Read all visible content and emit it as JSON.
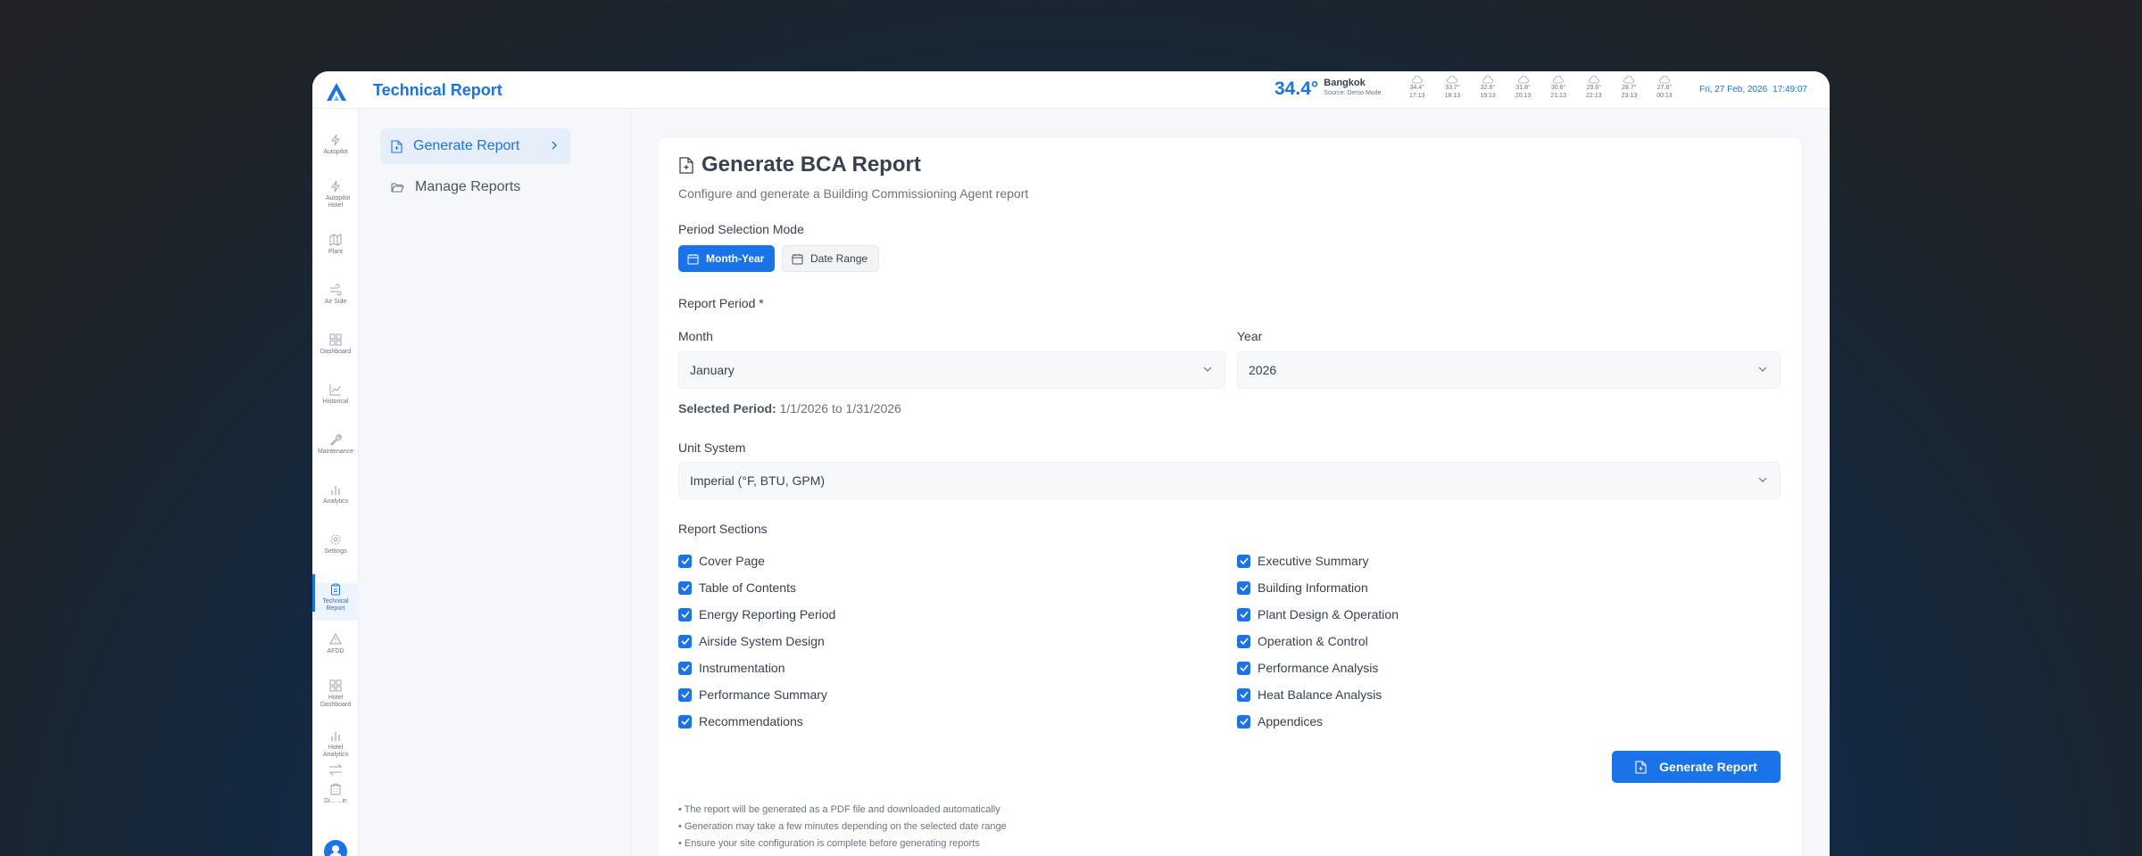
{
  "app": {
    "title": "Technical Report"
  },
  "weather": {
    "current_temp": "34.4°",
    "location": "Bangkok",
    "source": "Source: Demo Mode",
    "forecast": [
      {
        "temp": "34.4°",
        "time": "17:13"
      },
      {
        "temp": "33.7°",
        "time": "18:13"
      },
      {
        "temp": "32.6°",
        "time": "19:13"
      },
      {
        "temp": "31.8°",
        "time": "20:13"
      },
      {
        "temp": "30.6°",
        "time": "21:13"
      },
      {
        "temp": "29.6°",
        "time": "22:13"
      },
      {
        "temp": "28.7°",
        "time": "23:13"
      },
      {
        "temp": "27.6°",
        "time": "00:13"
      }
    ]
  },
  "datetime": {
    "date": "Fri, 27 Feb, 2026",
    "time": "17:49:07"
  },
  "sidebar": {
    "items": [
      {
        "label": "Autopilot",
        "icon": "bolt-icon"
      },
      {
        "label": "Autopilot Hotel",
        "icon": "bolt-icon"
      },
      {
        "label": "Plant",
        "icon": "map-icon"
      },
      {
        "label": "Air Side",
        "icon": "wind-icon"
      },
      {
        "label": "Dashboard",
        "icon": "grid-icon"
      },
      {
        "label": "Historical",
        "icon": "line-chart-icon"
      },
      {
        "label": "Maintenance",
        "icon": "wrench-icon"
      },
      {
        "label": "Analytics",
        "icon": "bar-chart-icon"
      },
      {
        "label": "Settings",
        "icon": "gear-icon"
      },
      {
        "label": "Technical Report",
        "icon": "clipboard-icon"
      },
      {
        "label": "AFDD",
        "icon": "warning-icon"
      },
      {
        "label": "Hotel Dashboard",
        "icon": "grid-icon"
      },
      {
        "label": "Hotel Analytics",
        "icon": "bar-chart-icon"
      },
      {
        "label": "Di... ...in",
        "icon": "building-icon"
      }
    ]
  },
  "subnav": {
    "generate": "Generate Report",
    "manage": "Manage Reports"
  },
  "main": {
    "title": "Generate BCA Report",
    "subtitle": "Configure and generate a Building Commissioning Agent report",
    "period_mode_label": "Period Selection Mode",
    "mode_month_year": "Month-Year",
    "mode_date_range": "Date Range",
    "report_period_label": "Report Period *",
    "month_label": "Month",
    "month_value": "January",
    "year_label": "Year",
    "year_value": "2026",
    "selected_period_label": "Selected Period:",
    "selected_period_value": "1/1/2026 to 1/31/2026",
    "unit_label": "Unit System",
    "unit_value": "Imperial (°F, BTU, GPM)",
    "sections_label": "Report Sections",
    "sections_left": [
      "Cover Page",
      "Table of Contents",
      "Energy Reporting Period",
      "Airside System Design",
      "Instrumentation",
      "Performance Summary",
      "Recommendations"
    ],
    "sections_right": [
      "Executive Summary",
      "Building Information",
      "Plant Design & Operation",
      "Operation & Control",
      "Performance Analysis",
      "Heat Balance Analysis",
      "Appendices"
    ],
    "generate_button": "Generate Report",
    "notes": [
      "• The report will be generated as a PDF file and downloaded automatically",
      "• Generation may take a few minutes depending on the selected date range",
      "• Ensure your site configuration is complete before generating reports"
    ]
  }
}
